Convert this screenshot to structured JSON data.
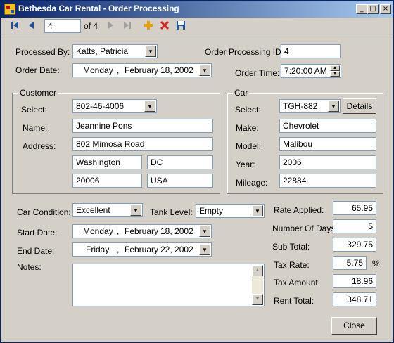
{
  "window": {
    "title": "Bethesda Car Rental - Order Processing",
    "controls": {
      "minimize": "_",
      "maximize": "□",
      "close": "×"
    }
  },
  "toolbar": {
    "position_value": "4",
    "count_label": "of 4",
    "icons": [
      "first-record-icon",
      "previous-record-icon",
      "next-record-icon",
      "last-record-icon",
      "add-icon",
      "delete-icon",
      "save-icon"
    ]
  },
  "header": {
    "processed_by_label": "Processed By:",
    "processed_by_value": "Katts, Patricia",
    "order_processing_id_label": "Order Processing ID:",
    "order_processing_id_value": "4",
    "order_date_label": "Order Date:",
    "order_date_day": "Monday",
    "order_date_sep": ",",
    "order_date_month": "February",
    "order_date_daynum": "18, 2002",
    "order_time_label": "Order Time:",
    "order_time_value": "7:20:00 AM"
  },
  "customer": {
    "group_title": "Customer",
    "select_label": "Select:",
    "select_value": "802-46-4006",
    "name_label": "Name:",
    "name_value": "Jeannine Pons",
    "address_label": "Address:",
    "address_value": "802 Mimosa Road",
    "city_value": "Washington",
    "state_value": "DC",
    "zip_value": "20006",
    "country_value": "USA"
  },
  "car": {
    "group_title": "Car",
    "select_label": "Select:",
    "select_value": "TGH-882",
    "details_button": "Details",
    "make_label": "Make:",
    "make_value": "Chevrolet",
    "model_label": "Model:",
    "model_value": "Malibou",
    "year_label": "Year:",
    "year_value": "2006",
    "mileage_label": "Mileage:",
    "mileage_value": "22884"
  },
  "order": {
    "car_condition_label": "Car Condition:",
    "car_condition_value": "Excellent",
    "tank_level_label": "Tank Level:",
    "tank_level_value": "Empty",
    "start_date_label": "Start Date:",
    "start_date_day": "Monday",
    "start_date_sep": ",",
    "start_date_month": "February",
    "start_date_daynum": "18, 2002",
    "end_date_label": "End Date:",
    "end_date_day": "Friday",
    "end_date_sep": ",",
    "end_date_month": "February",
    "end_date_daynum": "22, 2002",
    "notes_label": "Notes:",
    "notes_value": ""
  },
  "totals": {
    "rate_applied_label": "Rate Applied:",
    "rate_applied_value": "65.95",
    "number_of_days_label": "Number Of Days:",
    "number_of_days_value": "5",
    "sub_total_label": "Sub Total:",
    "sub_total_value": "329.75",
    "tax_rate_label": "Tax Rate:",
    "tax_rate_value": "5.75",
    "tax_rate_unit": "%",
    "tax_amount_label": "Tax Amount:",
    "tax_amount_value": "18.96",
    "rent_total_label": "Rent Total:",
    "rent_total_value": "348.71"
  },
  "close_button": "Close",
  "colors": {
    "titlebar_start": "#0a246a",
    "titlebar_end": "#a6caf0",
    "window_bg": "#d4d0c8",
    "nav_icon": "#1e4fa0",
    "add_icon": "#e8a000",
    "delete_icon": "#d92020",
    "save_icon": "#1e5aa8"
  }
}
